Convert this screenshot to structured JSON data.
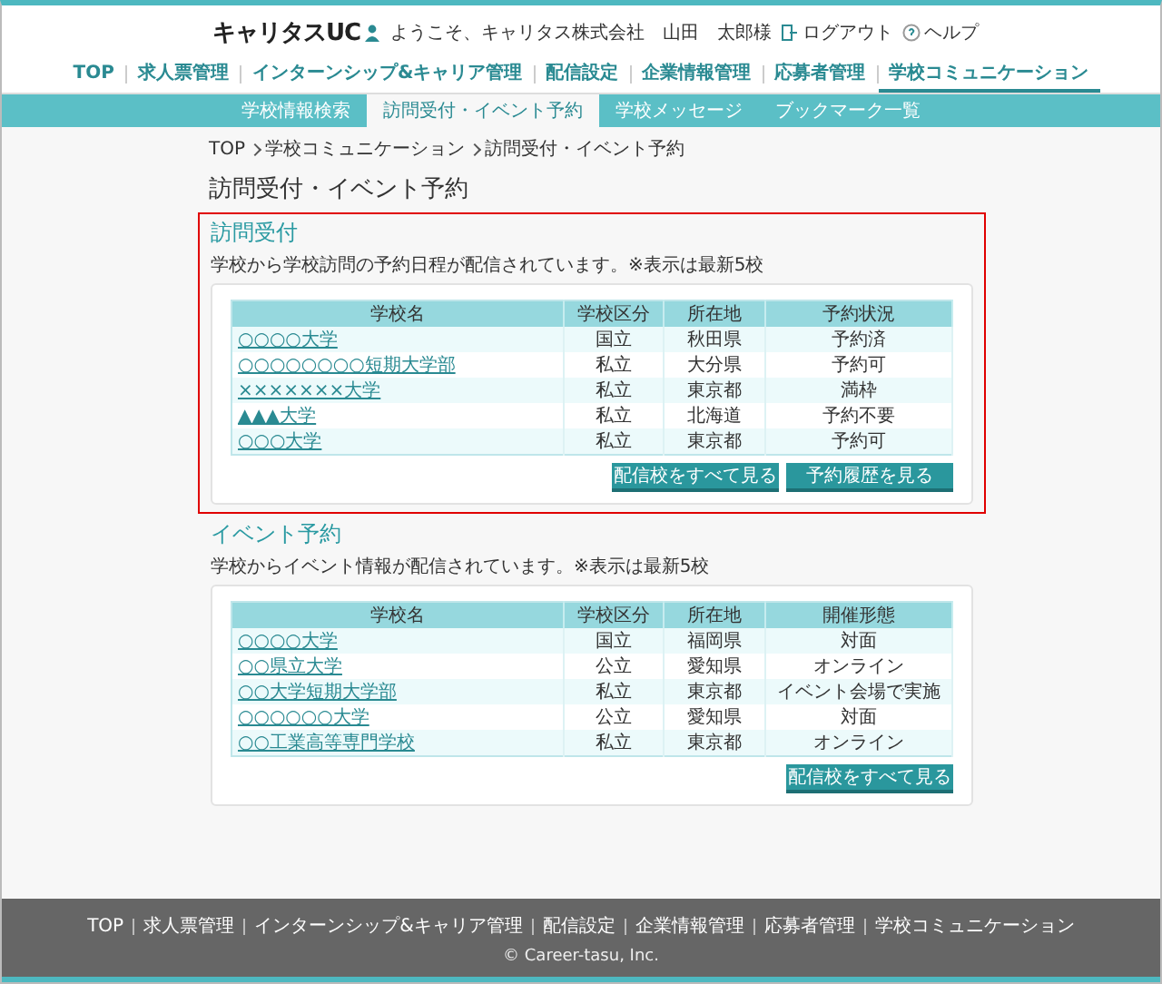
{
  "header": {
    "logo": "キャリタスUC",
    "greeting": "ようこそ、キャリタス株式会社　山田　太郎様",
    "logout": "ログアウト",
    "help": "ヘルプ"
  },
  "nav": [
    {
      "label": "TOP",
      "selected": false
    },
    {
      "label": "求人票管理",
      "selected": false
    },
    {
      "label": "インターンシップ&キャリア管理",
      "selected": false
    },
    {
      "label": "配信設定",
      "selected": false
    },
    {
      "label": "企業情報管理",
      "selected": false
    },
    {
      "label": "応募者管理",
      "selected": false
    },
    {
      "label": "学校コミュニケーション",
      "selected": true
    }
  ],
  "subnav": [
    {
      "label": "学校情報検索",
      "selected": false
    },
    {
      "label": "訪問受付・イベント予約",
      "selected": true
    },
    {
      "label": "学校メッセージ",
      "selected": false
    },
    {
      "label": "ブックマーク一覧",
      "selected": false
    }
  ],
  "breadcrumb": [
    "TOP",
    "学校コミュニケーション",
    "訪問受付・イベント予約"
  ],
  "page_title": "訪問受付・イベント予約",
  "sections": [
    {
      "title": "訪問受付",
      "highlighted": true,
      "description": "学校から学校訪問の予約日程が配信されています。※表示は最新5校",
      "columns": [
        "学校名",
        "学校区分",
        "所在地",
        "予約状況"
      ],
      "rows": [
        [
          "○○○○大学",
          "国立",
          "秋田県",
          "予約済"
        ],
        [
          "○○○○○○○○短期大学部",
          "私立",
          "大分県",
          "予約可"
        ],
        [
          "×××××××大学",
          "私立",
          "東京都",
          "満枠"
        ],
        [
          "▲▲▲大学",
          "私立",
          "北海道",
          "予約不要"
        ],
        [
          "○○○大学",
          "私立",
          "東京都",
          "予約可"
        ]
      ],
      "buttons": [
        "配信校をすべて見る",
        "予約履歴を見る"
      ]
    },
    {
      "title": "イベント予約",
      "highlighted": false,
      "description": "学校からイベント情報が配信されています。※表示は最新5校",
      "columns": [
        "学校名",
        "学校区分",
        "所在地",
        "開催形態"
      ],
      "rows": [
        [
          "○○○○大学",
          "国立",
          "福岡県",
          "対面"
        ],
        [
          "○○県立大学",
          "公立",
          "愛知県",
          "オンライン"
        ],
        [
          "○○大学短期大学部",
          "私立",
          "東京都",
          "イベント会場で実施"
        ],
        [
          "○○○○○○大学",
          "公立",
          "愛知県",
          "対面"
        ],
        [
          "○○工業高等専門学校",
          "私立",
          "東京都",
          "オンライン"
        ]
      ],
      "buttons": [
        "配信校をすべて見る"
      ]
    }
  ],
  "footer": {
    "nav": [
      "TOP",
      "求人票管理",
      "インターンシップ&キャリア管理",
      "配信設定",
      "企業情報管理",
      "応募者管理",
      "学校コミュニケーション"
    ],
    "copyright": "© Career-tasu, Inc."
  }
}
